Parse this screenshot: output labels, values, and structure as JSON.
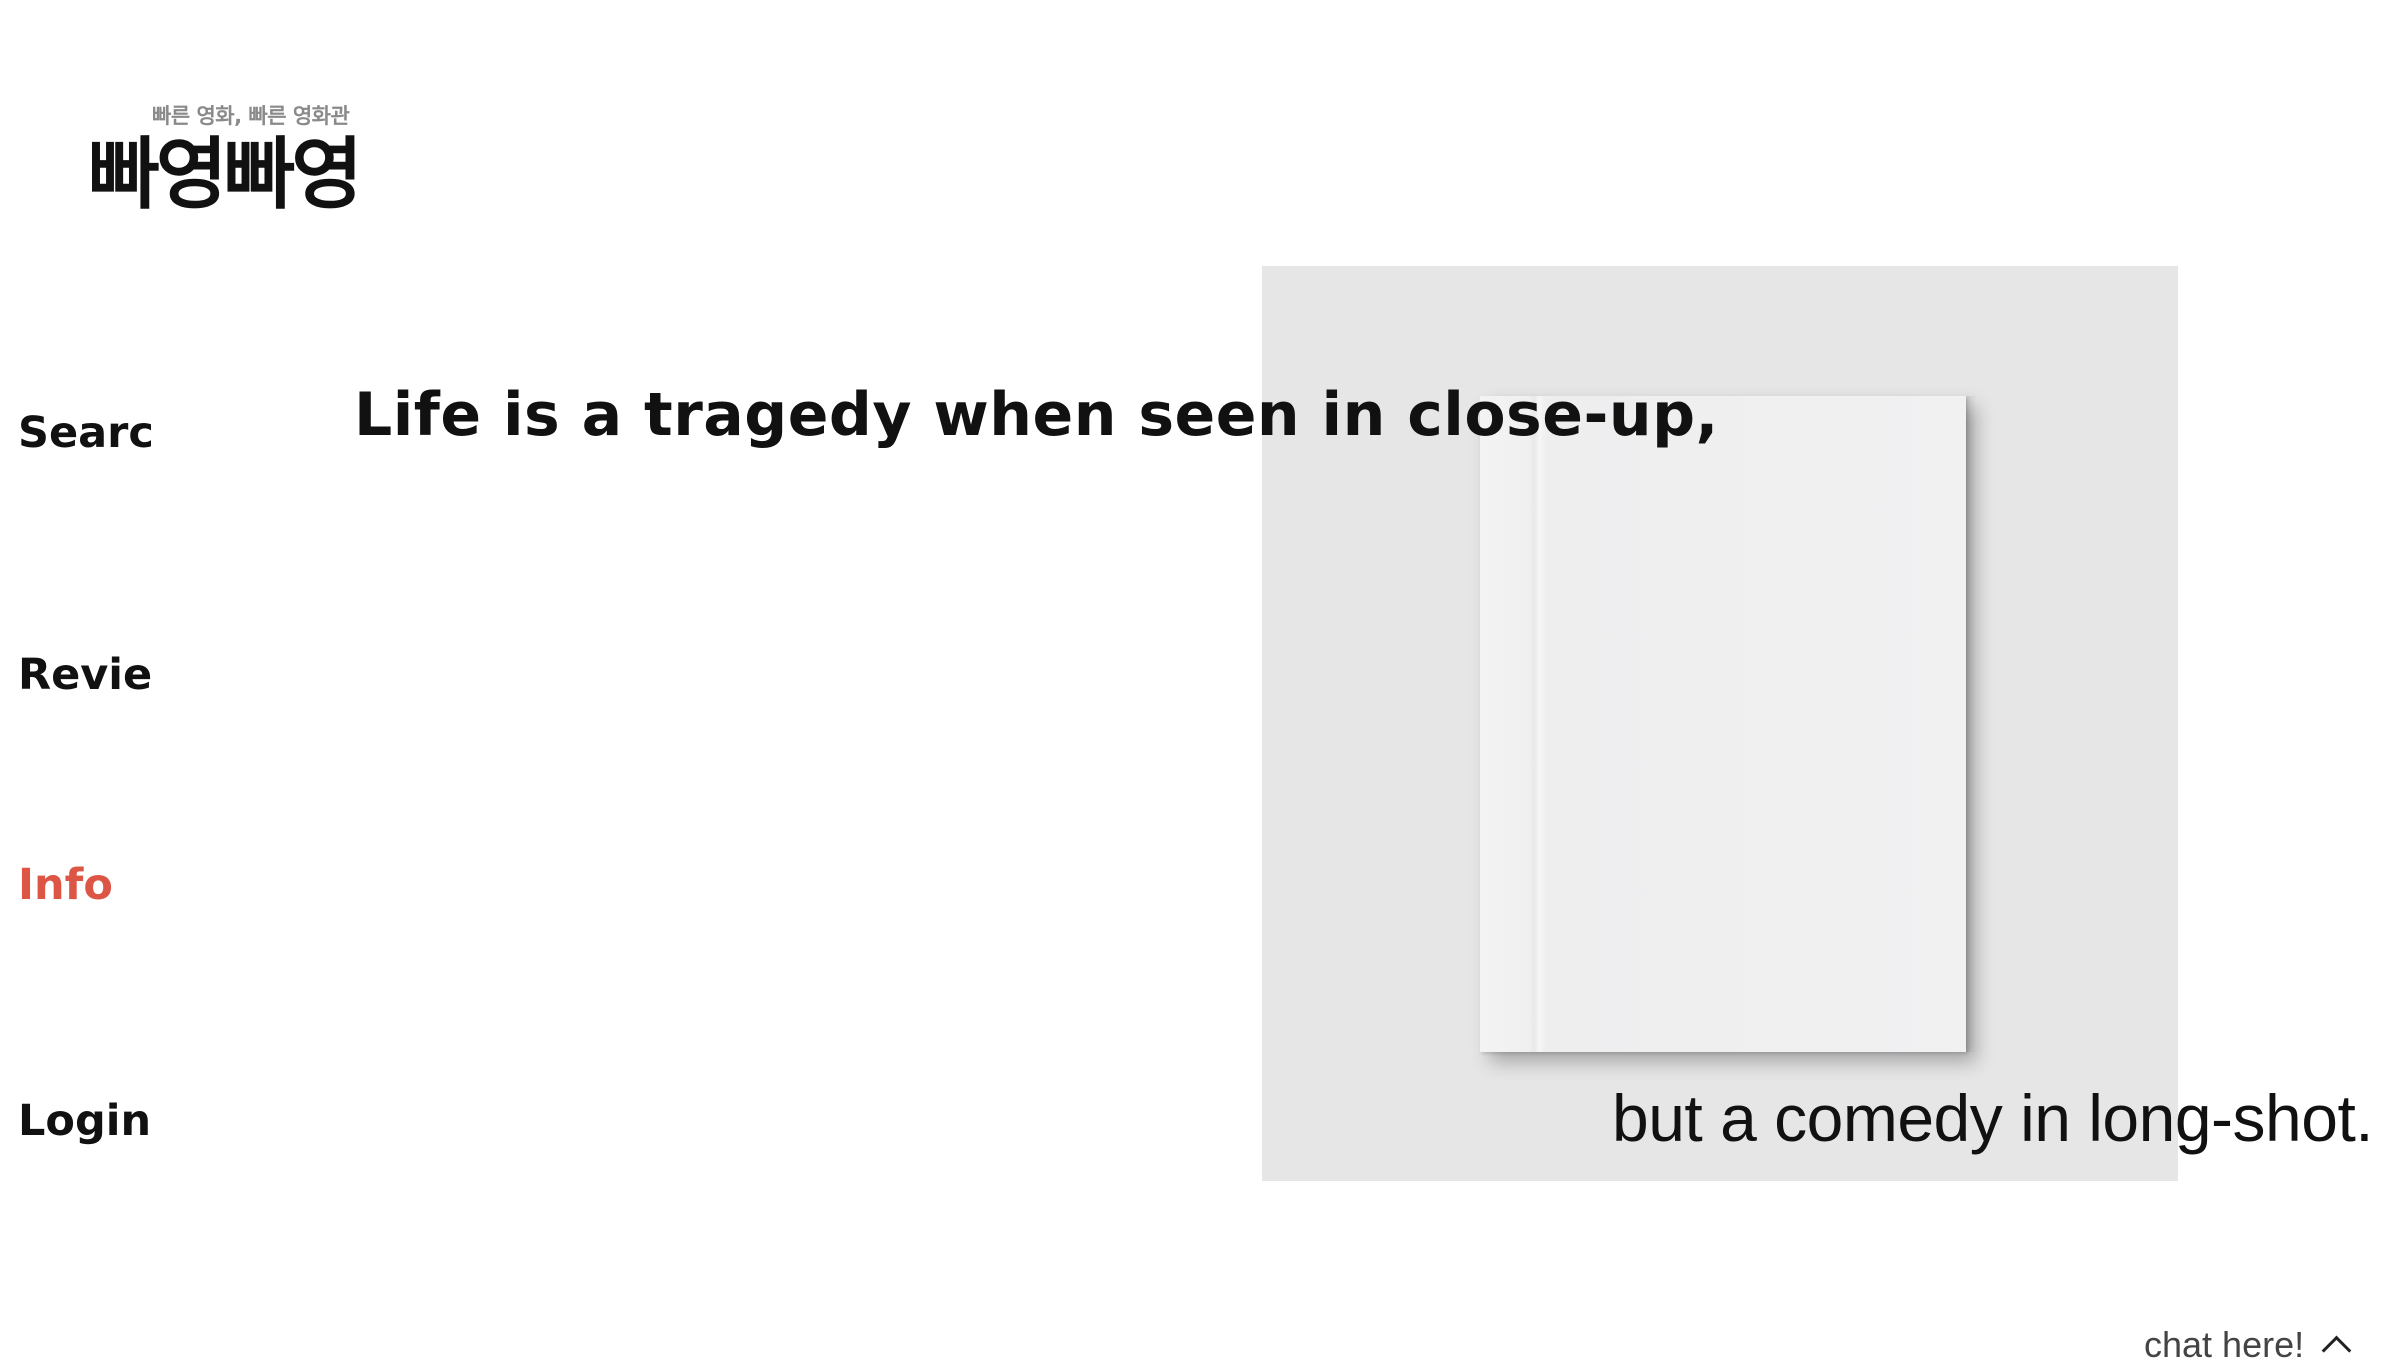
{
  "logo": {
    "tagline": "빠른 영화, 빠른 영화관",
    "name": "빠영빠영"
  },
  "nav": {
    "search": "Searc",
    "review": "Revie",
    "info": "Info",
    "login": "Login"
  },
  "hero": {
    "quote_top": "Life is a tragedy when seen in close-up,",
    "quote_bottom": "but a comedy in long-shot."
  },
  "chat": {
    "label": "chat here!",
    "icon": "chevron-up-icon"
  },
  "colors": {
    "accent": "#dd5544",
    "panel": "#e6e6e6"
  }
}
